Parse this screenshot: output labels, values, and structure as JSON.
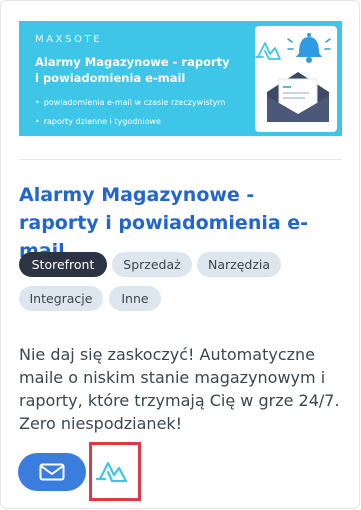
{
  "banner": {
    "brand": "MAXSOTE",
    "title": "Alarmy Magazynowe - raporty i powiadomienia e-mail",
    "bullets": [
      "powiadomienia e-mail w czasie rzeczywistym",
      "raporty dzienne i tygodniowe"
    ],
    "icons": [
      "app-logo-icon",
      "bell-icon",
      "envelope-icon"
    ]
  },
  "app": {
    "title": "Alarmy Magazynowe - raporty i powiadomienia e-mail",
    "tags": [
      "Storefront",
      "Sprzedaż",
      "Narzędzia",
      "Integracje",
      "Inne"
    ],
    "active_tag": "Storefront",
    "description": "Nie daj się zaskoczyć! Automatyczne maile o niskim stanie magazynowym i raporty, które trzymają Cię w grze 24/7. Zero niespodzianek!"
  },
  "actions": {
    "mail_icon": "mail-icon",
    "app_icon": "app-logo-icon"
  },
  "colors": {
    "banner_bg": "#3ec6e8",
    "title": "#2266cc",
    "active_tag_bg": "#2c3444",
    "tag_bg": "#dde5ef",
    "mail_button": "#3b7ddd",
    "highlight_border": "#d93a45",
    "logo": "#3ec6e8"
  }
}
